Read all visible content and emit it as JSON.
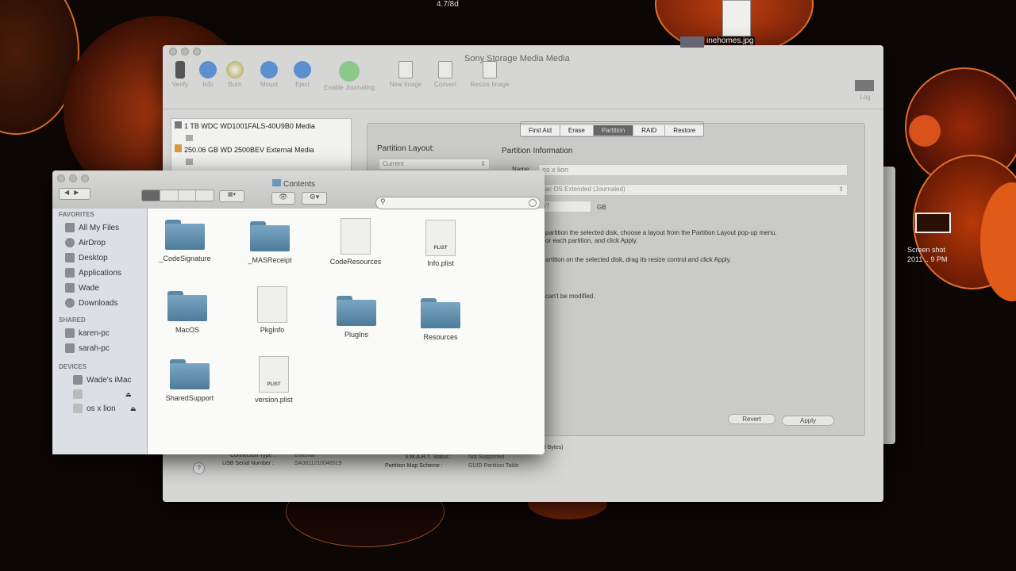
{
  "desktop": {
    "top_label": "4.7/8d",
    "file_1": "inehomes.jpg",
    "file_2_line1": "Screen shot",
    "file_2_line2": "2011 .. 9 PM"
  },
  "disk_utility": {
    "title": "Sony Storage Media Media",
    "toolbar": [
      {
        "label": "Verify",
        "icon": "microscope-icon"
      },
      {
        "label": "Info",
        "icon": "info-icon"
      },
      {
        "label": "Burn",
        "icon": "burn-icon"
      },
      {
        "label": "Mount",
        "icon": "mount-icon"
      },
      {
        "label": "Eject",
        "icon": "eject-icon"
      },
      {
        "label": "Enable Journaling",
        "icon": "journaling-icon"
      },
      {
        "label": "New Image",
        "icon": "new-image-icon"
      },
      {
        "label": "Convert",
        "icon": "convert-icon"
      },
      {
        "label": "Resize Image",
        "icon": "resize-image-icon"
      }
    ],
    "log_label": "Log",
    "disks": [
      "1 TB WDC WD1001FALS-40U9B0 Media",
      "250.06 GB WD 2500BEV External Media"
    ],
    "tabs": [
      "First Aid",
      "Erase",
      "Partition",
      "RAID",
      "Restore"
    ],
    "active_tab": "Partition",
    "partition_layout_label": "Partition Layout:",
    "partition_layout_value": "Current",
    "partition_info_label": "Partition Information",
    "name_label": "Name:",
    "name_value": "os x lion",
    "format_value": "Mac OS Extended (Journaled)",
    "size_value": ".87",
    "size_unit": "GB",
    "help_1a": "partition the selected disk, choose a layout from the Partition Layout pop-up menu,",
    "help_1b": "or each partition, and click Apply.",
    "help_2": "artition on the selected disk, drag its resize control and click Apply.",
    "help_3": "can't be modified.",
    "revert": "Revert",
    "apply": "Apply",
    "bytes_text": "68 Bytes)",
    "info": {
      "connection_type_label": "Connection Type :",
      "connection_type": "External",
      "usb_serial_label": "USB Serial Number :",
      "usb_serial": "SA0811210046519",
      "smart_label": "S.M.A.R.T. Status :",
      "smart": "Not Supported",
      "pms_label": "Partition Map Scheme :",
      "pms": "GUID Partition Table"
    }
  },
  "finder": {
    "title": "Contents",
    "search_placeholder": "",
    "sidebar": {
      "favorites_header": "FAVORITES",
      "favorites": [
        "All My Files",
        "AirDrop",
        "Desktop",
        "Applications",
        "Wade",
        "Downloads"
      ],
      "shared_header": "SHARED",
      "shared": [
        "karen-pc",
        "sarah-pc"
      ],
      "devices_header": "DEVICES",
      "devices": [
        "Wade's iMac",
        "",
        "os x lion"
      ]
    },
    "items": [
      {
        "name": "_CodeSignature",
        "kind": "folder"
      },
      {
        "name": "_MASReceipt",
        "kind": "folder"
      },
      {
        "name": "CodeResources",
        "kind": "file"
      },
      {
        "name": "Info.plist",
        "kind": "plist",
        "badge": "PLIST"
      },
      {
        "name": "MacOS",
        "kind": "folder"
      },
      {
        "name": "PkgInfo",
        "kind": "file"
      },
      {
        "name": "PlugIns",
        "kind": "folder"
      },
      {
        "name": "Resources",
        "kind": "folder"
      },
      {
        "name": "SharedSupport",
        "kind": "folder"
      },
      {
        "name": "version.plist",
        "kind": "plist",
        "badge": "PLIST"
      }
    ]
  }
}
